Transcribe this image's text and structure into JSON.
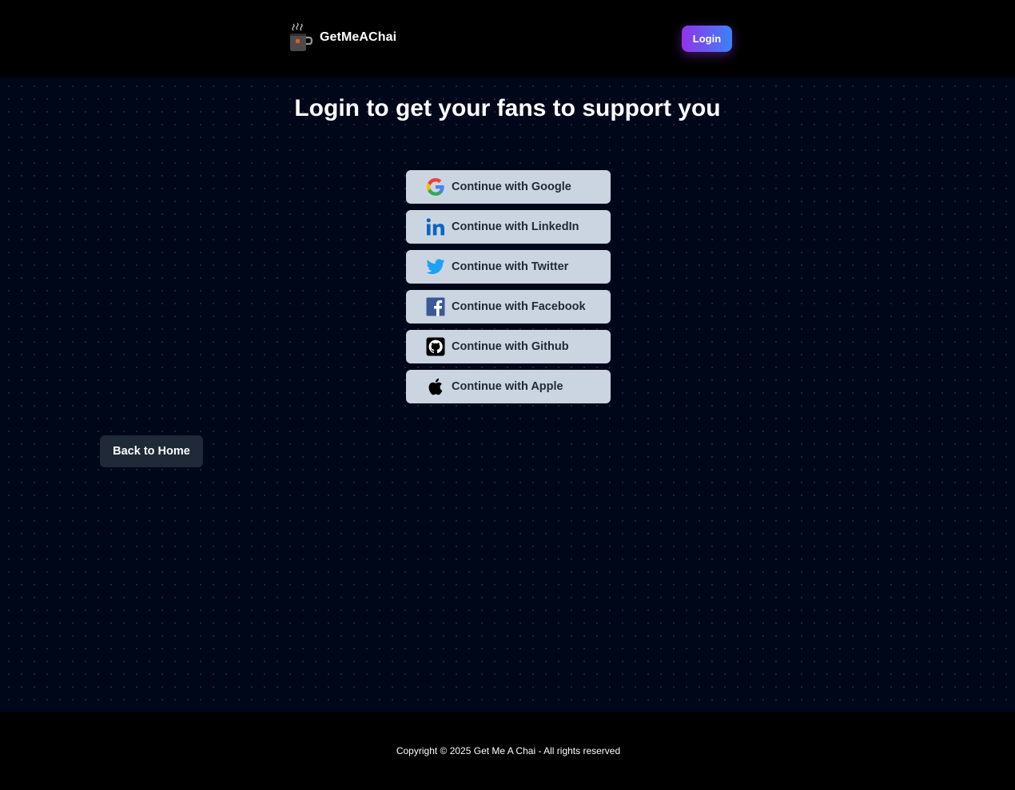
{
  "navbar": {
    "brand": "GetMeAChai",
    "logo_icon": "tea-cup-icon",
    "login_label": "Login"
  },
  "main": {
    "title": "Login to get your fans to support you",
    "providers": [
      {
        "label": "Continue with Google",
        "icon": "google-icon"
      },
      {
        "label": "Continue with LinkedIn",
        "icon": "linkedin-icon"
      },
      {
        "label": "Continue with Twitter",
        "icon": "twitter-icon"
      },
      {
        "label": "Continue with Facebook",
        "icon": "facebook-icon"
      },
      {
        "label": "Continue with Github",
        "icon": "github-icon"
      },
      {
        "label": "Continue with Apple",
        "icon": "apple-icon"
      }
    ],
    "back_home_label": "Back to Home"
  },
  "footer": {
    "copyright": "Copyright © 2025 Get Me A Chai - All rights reserved"
  },
  "colors": {
    "page_bg": "#000719",
    "nav_bg": "#000000",
    "button_bg": "#cbd5e1",
    "button_text": "#1f2937",
    "back_button_bg": "#1f2937",
    "login_gradient_start": "#9333ea",
    "login_gradient_end": "#3b82f6"
  }
}
